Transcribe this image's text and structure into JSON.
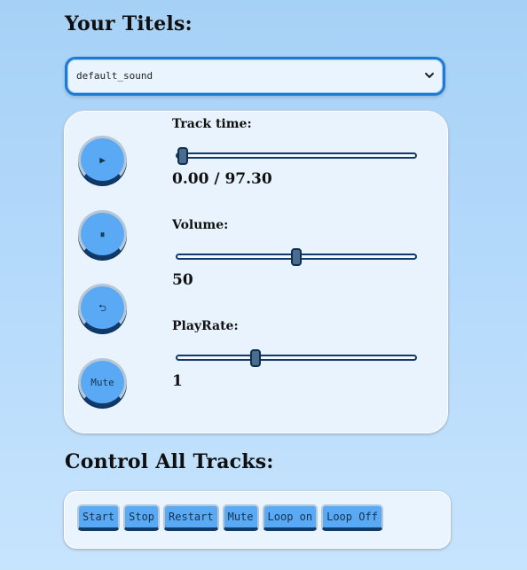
{
  "titles_heading": "Your Titels:",
  "sound_select": {
    "selected": "default_sound"
  },
  "player": {
    "play_icon": "play-icon",
    "pause_icon": "pause-icon",
    "restart_icon": "undo-icon",
    "mute_label": "Mute",
    "track_time_label": "Track time:",
    "track_time_value": "0.00 / 97.30",
    "track_time_fraction": 0.0,
    "volume_label": "Volume:",
    "volume_value": "50",
    "volume_fraction": 0.5,
    "playrate_label": "PlayRate:",
    "playrate_value": "1",
    "playrate_fraction": 0.32
  },
  "control_all_heading": "Control All Tracks:",
  "control_all_buttons": [
    "Start",
    "Stop",
    "Restart",
    "Mute",
    "Loop on",
    "Loop Off"
  ],
  "colors": {
    "button_blue": "#5aa9f4",
    "dark_navy": "#0f3a6a",
    "select_border": "#1d7bd6"
  }
}
